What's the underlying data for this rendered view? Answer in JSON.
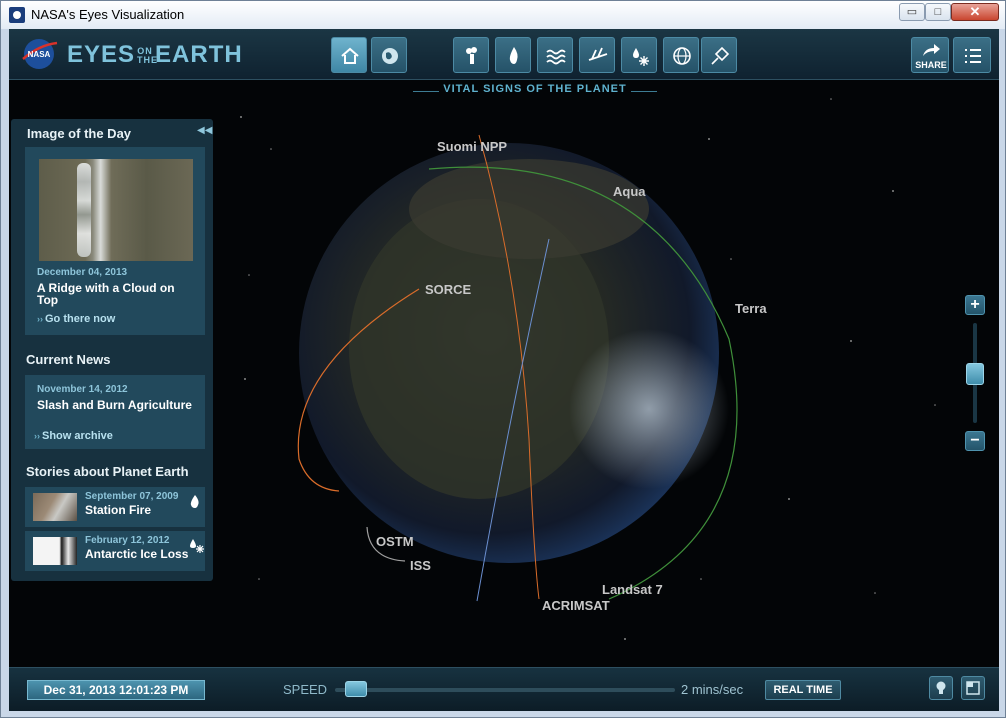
{
  "window": {
    "title": "NASA's Eyes Visualization",
    "min_glyph": "▭",
    "max_glyph": "□",
    "close_glyph": "✕"
  },
  "header": {
    "brand_left": "EYES",
    "brand_on": "ON",
    "brand_the": "THE",
    "brand_right": "EARTH",
    "nav_icons": [
      "home-icon",
      "globe-icon",
      "smokestack-icon",
      "fire-icon",
      "water-waves-icon",
      "ice-sheet-icon",
      "water-ice-icon",
      "grid-globe-icon",
      "satellite-icon"
    ],
    "share_label": "SHARE",
    "menu_icon": "list-menu-icon"
  },
  "vital_signs": "VITAL SIGNS OF THE PLANET",
  "sidebar": {
    "iod": {
      "heading": "Image of the Day",
      "date": "December 04, 2013",
      "title": "A Ridge with a Cloud on Top",
      "link": "Go there now"
    },
    "news": {
      "heading": "Current News",
      "date": "November 14, 2012",
      "title": "Slash and Burn Agriculture",
      "link": "Show archive"
    },
    "stories": {
      "heading": "Stories about Planet Earth",
      "items": [
        {
          "date": "September 07, 2009",
          "title": "Station Fire",
          "icon": "fire-icon"
        },
        {
          "date": "February 12, 2012",
          "title": "Antarctic Ice Loss",
          "icon": "water-ice-icon"
        }
      ]
    }
  },
  "satellites": [
    "Suomi NPP",
    "Aqua",
    "Terra",
    "SORCE",
    "OSTM",
    "ISS",
    "Landsat 7",
    "ACRIMSAT"
  ],
  "zoom": {
    "plus": "+",
    "minus": "−"
  },
  "footer": {
    "datetime": "Dec 31, 2013 12:01:23 PM",
    "speed_label": "SPEED",
    "speed_value": "2 mins/sec",
    "realtime": "REAL TIME"
  },
  "colors": {
    "accent": "#7fc3dc",
    "orbit_orange": "#d96c2a",
    "orbit_green": "#3f8f3a",
    "orbit_blue": "#6b8fd0"
  }
}
